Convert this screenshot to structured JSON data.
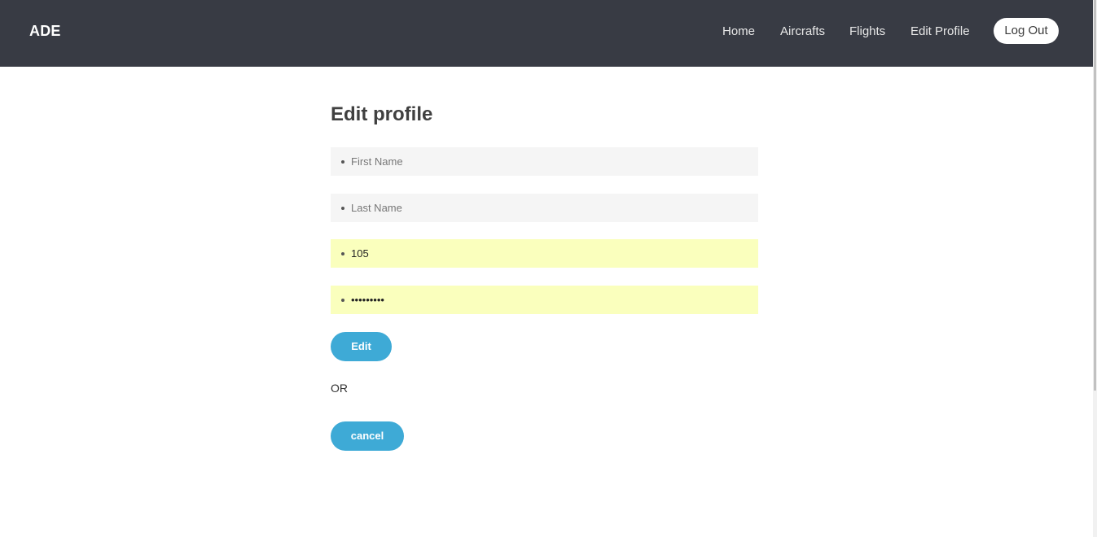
{
  "header": {
    "brand": "ADE",
    "nav": {
      "home": "Home",
      "aircrafts": "Aircrafts",
      "flights": "Flights",
      "edit_profile": "Edit Profile"
    },
    "logout_label": "Log Out"
  },
  "form": {
    "title": "Edit profile",
    "first_name": {
      "placeholder": "First Name",
      "value": ""
    },
    "last_name": {
      "placeholder": "Last Name",
      "value": ""
    },
    "id_field": {
      "value": "105"
    },
    "password_field": {
      "value": "password1"
    },
    "edit_label": "Edit",
    "or_label": "OR",
    "cancel_label": "cancel"
  },
  "colors": {
    "navbar_bg": "#383b44",
    "button_bg": "#3eaad6",
    "autofill_bg": "#faffbd",
    "input_bg": "#f5f5f5"
  }
}
